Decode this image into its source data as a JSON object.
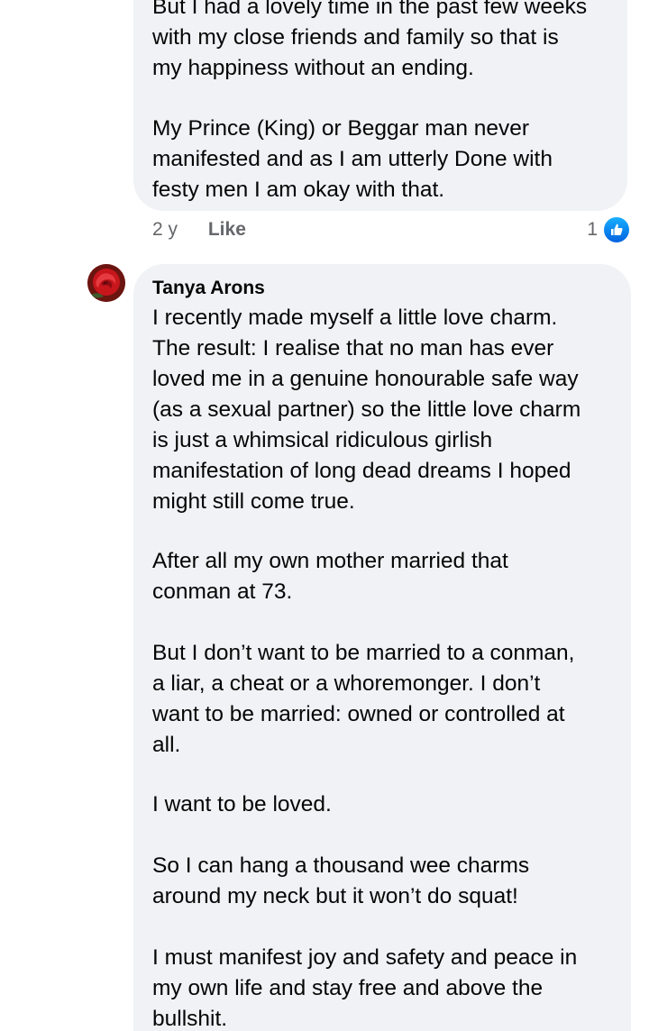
{
  "comment_1": {
    "paragraphs": [
      [
        "But I had a lovely time in the past few weeks",
        "with my close friends and family so that is",
        "my happiness without an ending."
      ],
      [
        "My Prince (King) or Beggar man never",
        "manifested and as I am utterly Done with",
        "festy men I am okay with that."
      ]
    ],
    "time": "2 y",
    "like_label": "Like",
    "reaction_count": "1",
    "reaction_icon": "thumbs-up-icon"
  },
  "comment_2": {
    "author": "Tanya Arons",
    "avatar": "red-rose-avatar",
    "paragraphs": [
      [
        "I recently made myself a little love charm.",
        "The result:  I realise that no man has ever",
        "loved me in a genuine honourable safe way",
        "(as a sexual partner) so the little love charm",
        "is just a whimsical ridiculous girlish",
        "manifestation of long dead dreams I hoped",
        "might still come true."
      ],
      [
        "After all my own mother married that",
        "conman at 73."
      ],
      [
        "But I don’t want to be married to a conman,",
        "a liar, a cheat or a whoremonger.  I don’t",
        "want to be married: owned or controlled at",
        "all."
      ],
      [
        "I want to be loved."
      ],
      [
        "So I can hang a thousand wee charms",
        "around my neck but it won’t do squat!"
      ],
      [
        "I must manifest joy and safety and peace in",
        "my own life and stay free and above the",
        "bullshit."
      ]
    ]
  }
}
